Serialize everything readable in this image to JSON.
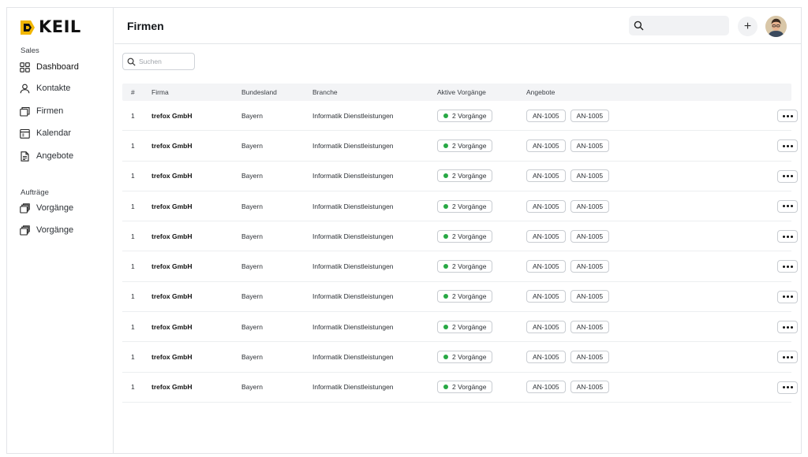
{
  "brand": {
    "name": "KEIL",
    "mark_color": "#f2b705"
  },
  "sidebar": {
    "section_sales": "Sales",
    "sales_items": [
      {
        "label": "Dashboard",
        "icon": "grid-icon"
      },
      {
        "label": "Kontakte",
        "icon": "user-icon"
      },
      {
        "label": "Firmen",
        "icon": "company-icon"
      },
      {
        "label": "Kalendar",
        "icon": "calendar-icon"
      },
      {
        "label": "Angebote",
        "icon": "document-icon"
      }
    ],
    "section_orders": "Aufträge",
    "order_items": [
      {
        "label": "Vorgänge",
        "icon": "stack-icon"
      },
      {
        "label": "Vorgänge",
        "icon": "stack-icon"
      }
    ]
  },
  "header": {
    "title": "Firmen",
    "search_placeholder": "",
    "add_label": "+",
    "avatar_icon": "user-avatar"
  },
  "search": {
    "placeholder": "Suchen",
    "value": ""
  },
  "table": {
    "columns": [
      "#",
      "Firma",
      "Bundesland",
      "Branche",
      "Aktive Vorgänge",
      "Angebote"
    ],
    "rows": [
      {
        "num": "1",
        "firma": "trefox GmbH",
        "bundesland": "Bayern",
        "branche": "Informatik Dienstleistungen",
        "aktiv": "2 Vorgänge",
        "angebote": [
          "AN-1005",
          "AN-1005"
        ]
      },
      {
        "num": "1",
        "firma": "trefox GmbH",
        "bundesland": "Bayern",
        "branche": "Informatik Dienstleistungen",
        "aktiv": "2 Vorgänge",
        "angebote": [
          "AN-1005",
          "AN-1005"
        ]
      },
      {
        "num": "1",
        "firma": "trefox GmbH",
        "bundesland": "Bayern",
        "branche": "Informatik Dienstleistungen",
        "aktiv": "2 Vorgänge",
        "angebote": [
          "AN-1005",
          "AN-1005"
        ]
      },
      {
        "num": "1",
        "firma": "trefox GmbH",
        "bundesland": "Bayern",
        "branche": "Informatik Dienstleistungen",
        "aktiv": "2 Vorgänge",
        "angebote": [
          "AN-1005",
          "AN-1005"
        ]
      },
      {
        "num": "1",
        "firma": "trefox GmbH",
        "bundesland": "Bayern",
        "branche": "Informatik Dienstleistungen",
        "aktiv": "2 Vorgänge",
        "angebote": [
          "AN-1005",
          "AN-1005"
        ]
      },
      {
        "num": "1",
        "firma": "trefox GmbH",
        "bundesland": "Bayern",
        "branche": "Informatik Dienstleistungen",
        "aktiv": "2 Vorgänge",
        "angebote": [
          "AN-1005",
          "AN-1005"
        ]
      },
      {
        "num": "1",
        "firma": "trefox GmbH",
        "bundesland": "Bayern",
        "branche": "Informatik Dienstleistungen",
        "aktiv": "2 Vorgänge",
        "angebote": [
          "AN-1005",
          "AN-1005"
        ]
      },
      {
        "num": "1",
        "firma": "trefox GmbH",
        "bundesland": "Bayern",
        "branche": "Informatik Dienstleistungen",
        "aktiv": "2 Vorgänge",
        "angebote": [
          "AN-1005",
          "AN-1005"
        ]
      },
      {
        "num": "1",
        "firma": "trefox GmbH",
        "bundesland": "Bayern",
        "branche": "Informatik Dienstleistungen",
        "aktiv": "2 Vorgänge",
        "angebote": [
          "AN-1005",
          "AN-1005"
        ]
      },
      {
        "num": "1",
        "firma": "trefox GmbH",
        "bundesland": "Bayern",
        "branche": "Informatik Dienstleistungen",
        "aktiv": "2 Vorgänge",
        "angebote": [
          "AN-1005",
          "AN-1005"
        ]
      }
    ],
    "row_action_icon": "more-icon",
    "status_color": "#27a844"
  }
}
